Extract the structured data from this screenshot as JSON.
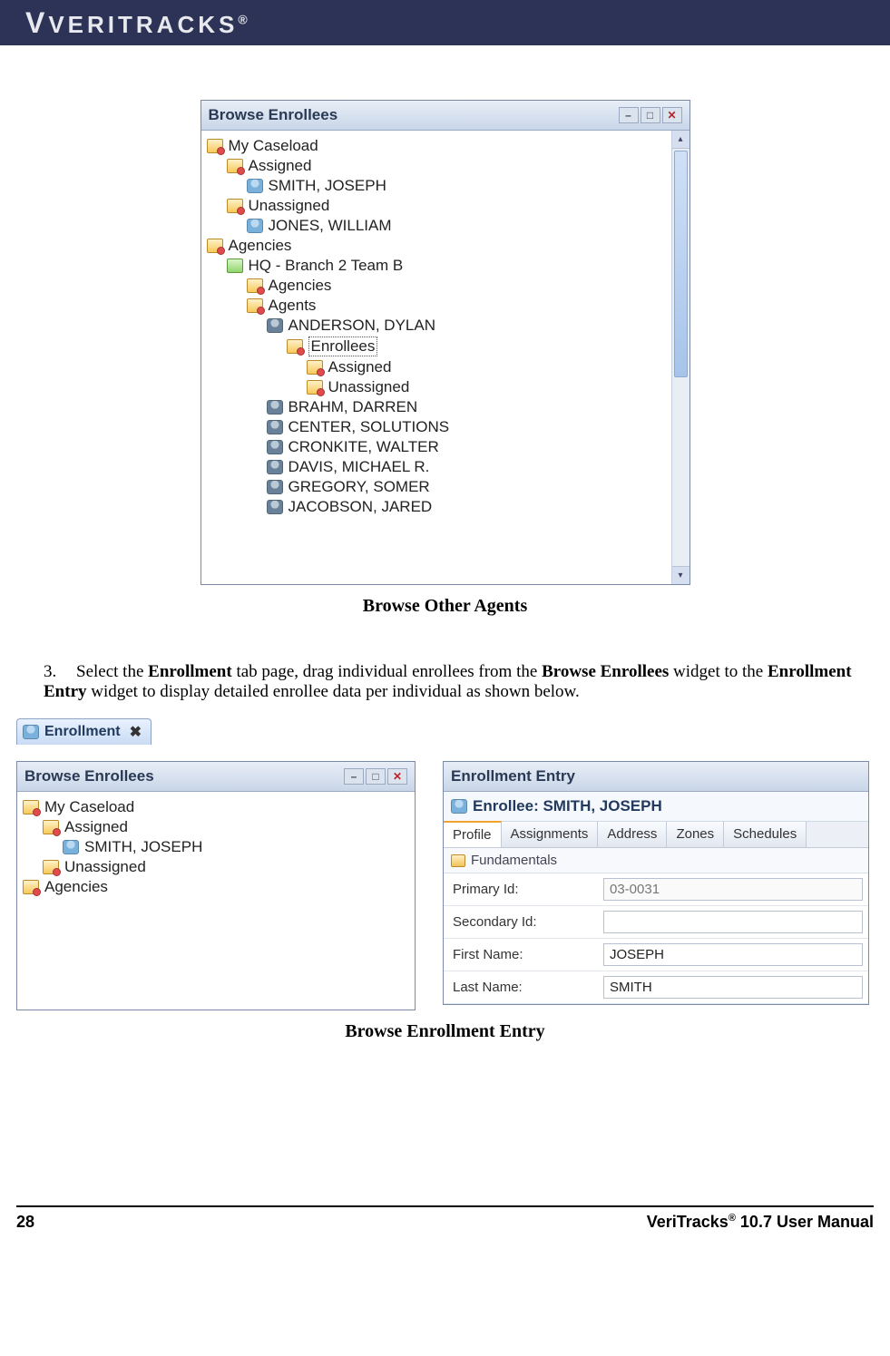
{
  "header": {
    "brand": "VERITRACKS",
    "reg": "®"
  },
  "fig1": {
    "panel_title": "Browse Enrollees",
    "caption": "Browse Other Agents",
    "tree": {
      "my_caseload": "My Caseload",
      "assigned": "Assigned",
      "smith": "SMITH, JOSEPH",
      "unassigned": "Unassigned",
      "jones": "JONES, WILLIAM",
      "agencies": "Agencies",
      "hq": "HQ - Branch 2 Team B",
      "sub_agencies": "Agencies",
      "agents": "Agents",
      "anderson": "ANDERSON, DYLAN",
      "enrollees": "Enrollees",
      "enrollees_assigned": "Assigned",
      "enrollees_unassigned": "Unassigned",
      "brahm": "BRAHM, DARREN",
      "center": "CENTER, SOLUTIONS",
      "cronkite": "CRONKITE, WALTER",
      "davis": "DAVIS, MICHAEL R.",
      "gregory": "GREGORY, SOMER",
      "jacobson": "JACOBSON, JARED"
    }
  },
  "step": {
    "num": "3.",
    "text_1": "Select the ",
    "b1": "Enrollment",
    "text_2": " tab page, drag individual enrollees from the ",
    "b2": "Browse Enrollees",
    "text_3": " widget to the ",
    "b3": "Enrollment Entry",
    "text_4": " widget to display detailed enrollee data per individual as shown below."
  },
  "fig2": {
    "tab_label": "Enrollment",
    "caption": "Browse Enrollment Entry",
    "left": {
      "panel_title": "Browse Enrollees",
      "my_caseload": "My Caseload",
      "assigned": "Assigned",
      "smith": "SMITH, JOSEPH",
      "unassigned": "Unassigned",
      "agencies": "Agencies"
    },
    "right": {
      "panel_title": "Enrollment Entry",
      "enrollee_label": "Enrollee: SMITH, JOSEPH",
      "tabs": {
        "profile": "Profile",
        "assignments": "Assignments",
        "address": "Address",
        "zones": "Zones",
        "schedules": "Schedules"
      },
      "fundamentals": "Fundamentals",
      "fields": {
        "primary_id_label": "Primary Id:",
        "primary_id_value": "03-0031",
        "secondary_id_label": "Secondary Id:",
        "secondary_id_value": "",
        "first_name_label": "First Name:",
        "first_name_value": "JOSEPH",
        "last_name_label": "Last Name:",
        "last_name_value": "SMITH"
      }
    }
  },
  "footer": {
    "page_num": "28",
    "product": "VeriTracks",
    "reg": "®",
    "tail": " 10.7 User Manual"
  }
}
